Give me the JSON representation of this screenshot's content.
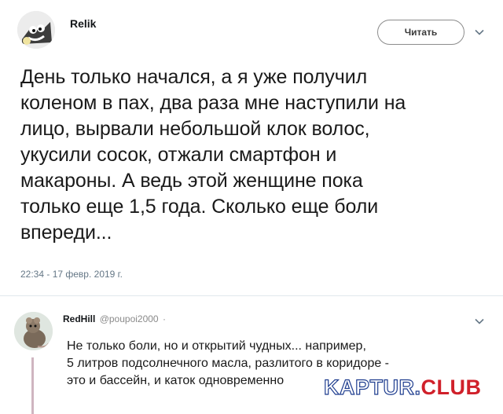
{
  "tweet": {
    "author": "Relik",
    "follow_label": "Читать",
    "text_lines": [
      "День только начался, а я уже получил",
      "коленом в пах, два раза мне наступили на",
      "лицо, вырвали небольшой клок волос,",
      "укусили сосок, отжали смартфон и",
      "макароны. А ведь этой женщине пока",
      "только еще 1,5 года. Сколько еще боли",
      "впереди..."
    ],
    "timestamp": "22:34 - 17 февр. 2019 г."
  },
  "reply": {
    "author": "RedHill",
    "handle": "@poupoi2000",
    "separator": "·",
    "text_lines": [
      "Не только боли, но и открытий чудных... например,",
      "5 литров подсолнечного масла, разлитого в коридоре -",
      "это и бассейн, и каток одновременно"
    ]
  },
  "watermark": {
    "part1": "KAPTUR.",
    "part2": "CLUB"
  },
  "icons": {
    "more": "chevron-down-icon"
  }
}
